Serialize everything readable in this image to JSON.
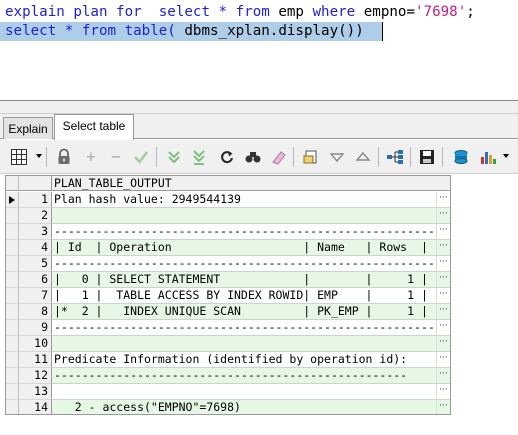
{
  "editor": {
    "line1": [
      {
        "t": "explain plan for  select * from ",
        "c": "kw"
      },
      {
        "t": "emp",
        "c": "id"
      },
      {
        "t": " where ",
        "c": "kw"
      },
      {
        "t": "empno=",
        "c": "id"
      },
      {
        "t": "'7698'",
        "c": "str"
      },
      {
        "t": ";",
        "c": "id"
      }
    ],
    "line2": [
      {
        "t": "select * from table( ",
        "c": "kw"
      },
      {
        "t": "dbms_xplan.display())",
        "c": "id"
      }
    ]
  },
  "tabs": [
    {
      "label": "Explain",
      "active": false
    },
    {
      "label": "Select table",
      "active": true
    }
  ],
  "toolbar": {
    "icons": [
      "grid-layout-icon",
      "lock-icon",
      "add-record-icon",
      "delete-record-icon",
      "post-edit-icon",
      "fetch-next-icon",
      "fetch-all-icon",
      "refresh-icon",
      "find-icon",
      "clear-icon",
      "query-by-example-icon",
      "filter-icon",
      "sort-icon",
      "tree-view-icon",
      "save-icon",
      "export-icon",
      "chart-icon"
    ]
  },
  "grid": {
    "column_header": "PLAN_TABLE_OUTPUT",
    "rows": [
      {
        "n": "1",
        "v": "Plan hash value: 2949544139"
      },
      {
        "n": "2",
        "v": ""
      },
      {
        "n": "3",
        "v": "--------------------------------------------------------------"
      },
      {
        "n": "4",
        "v": "| Id  | Operation                   | Name   | Rows  |"
      },
      {
        "n": "5",
        "v": "--------------------------------------------------------------"
      },
      {
        "n": "6",
        "v": "|   0 | SELECT STATEMENT            |        |     1 |"
      },
      {
        "n": "7",
        "v": "|   1 |  TABLE ACCESS BY INDEX ROWID| EMP    |     1 |"
      },
      {
        "n": "8",
        "v": "|*  2 |   INDEX UNIQUE SCAN         | PK_EMP |     1 |"
      },
      {
        "n": "9",
        "v": "--------------------------------------------------------------"
      },
      {
        "n": "10",
        "v": ""
      },
      {
        "n": "11",
        "v": "Predicate Information (identified by operation id):"
      },
      {
        "n": "12",
        "v": "---------------------------------------------------"
      },
      {
        "n": "13",
        "v": ""
      },
      {
        "n": "14",
        "v": "   2 - access(\"EMPNO\"=7698)"
      }
    ],
    "ellipsis": "···"
  }
}
